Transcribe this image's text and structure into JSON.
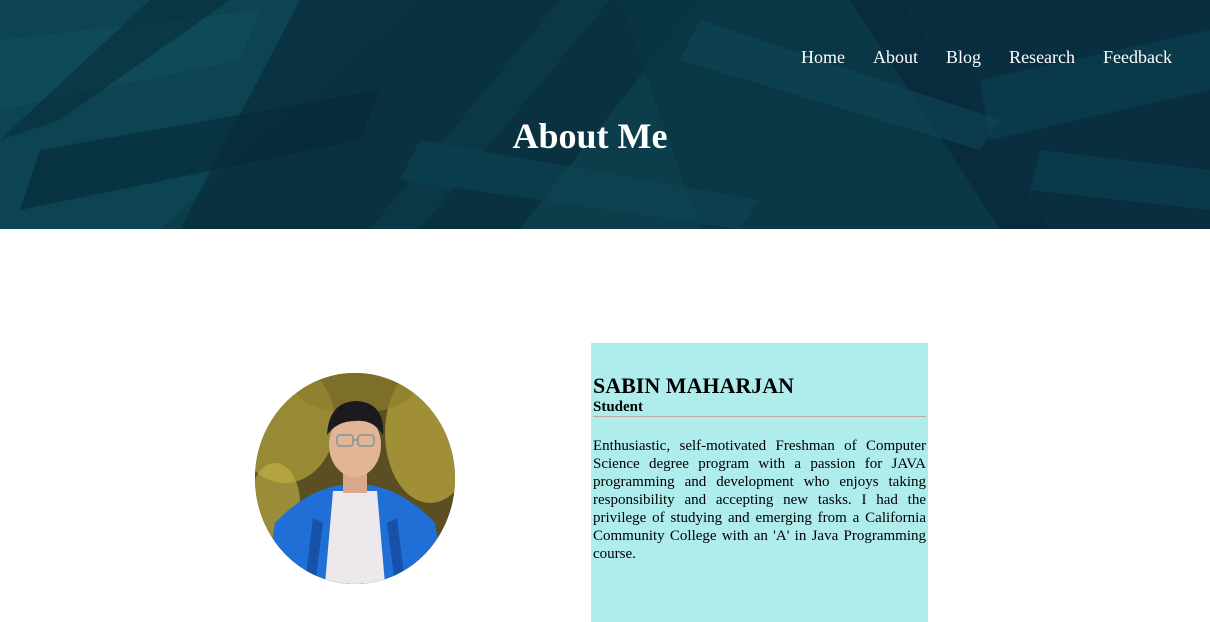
{
  "nav": {
    "items": [
      {
        "label": "Home"
      },
      {
        "label": "About"
      },
      {
        "label": "Blog"
      },
      {
        "label": "Research"
      },
      {
        "label": "Feedback"
      }
    ]
  },
  "hero": {
    "title": "About Me"
  },
  "profile": {
    "name": "SABIN MAHARJAN",
    "role": "Student",
    "bio": "Enthusiastic, self-motivated Freshman of Computer Science degree program with a passion for JAVA programming and development who enjoys taking responsibility and accepting new tasks. I had the privilege of studying and emerging from a California Community College with an 'A' in Java Programming course.",
    "card_color": "#afecec"
  },
  "colors": {
    "hero_bg": "#0a3a48",
    "hero_text": "#ffffff"
  }
}
